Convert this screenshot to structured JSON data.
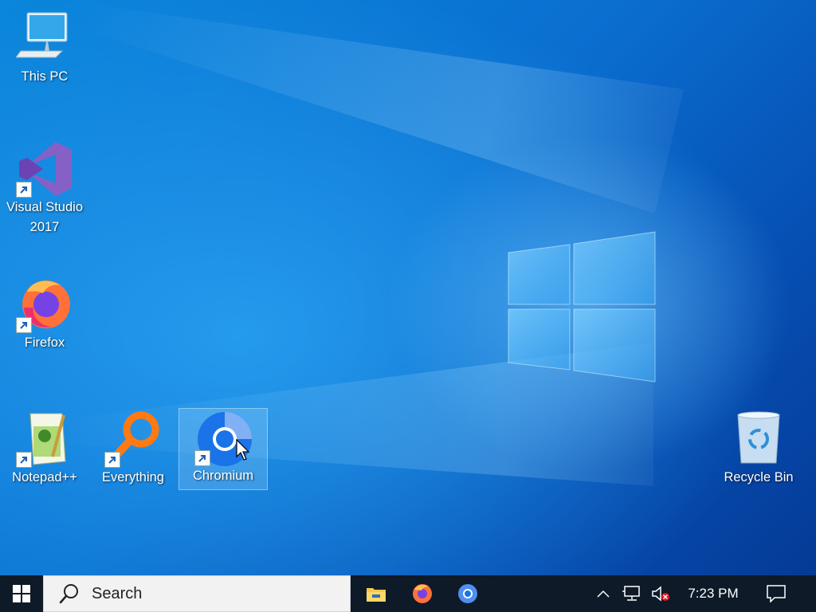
{
  "desktop": {
    "icons": [
      {
        "label": "This PC",
        "icon": "this-pc-icon"
      },
      {
        "label_line1": "Visual Studio",
        "label_line2": "2017",
        "icon": "visual-studio-icon"
      },
      {
        "label": "Firefox",
        "icon": "firefox-icon"
      },
      {
        "label": "Notepad++",
        "icon": "notepad-plus-plus-icon"
      },
      {
        "label": "Everything",
        "icon": "everything-icon"
      },
      {
        "label": "Chromium",
        "icon": "chromium-icon",
        "selected": true
      },
      {
        "label": "Recycle Bin",
        "icon": "recycle-bin-icon"
      }
    ]
  },
  "taskbar": {
    "search_placeholder": "Search",
    "pinned": [
      "file-explorer-icon",
      "firefox-icon",
      "chromium-icon"
    ],
    "tray": [
      "show-hidden-icons-chevron",
      "network-icon",
      "volume-muted-icon"
    ],
    "clock": "7:23 PM",
    "colors": {
      "taskbar_bg": "#0e1a28",
      "accent": "#0a78d7"
    }
  }
}
